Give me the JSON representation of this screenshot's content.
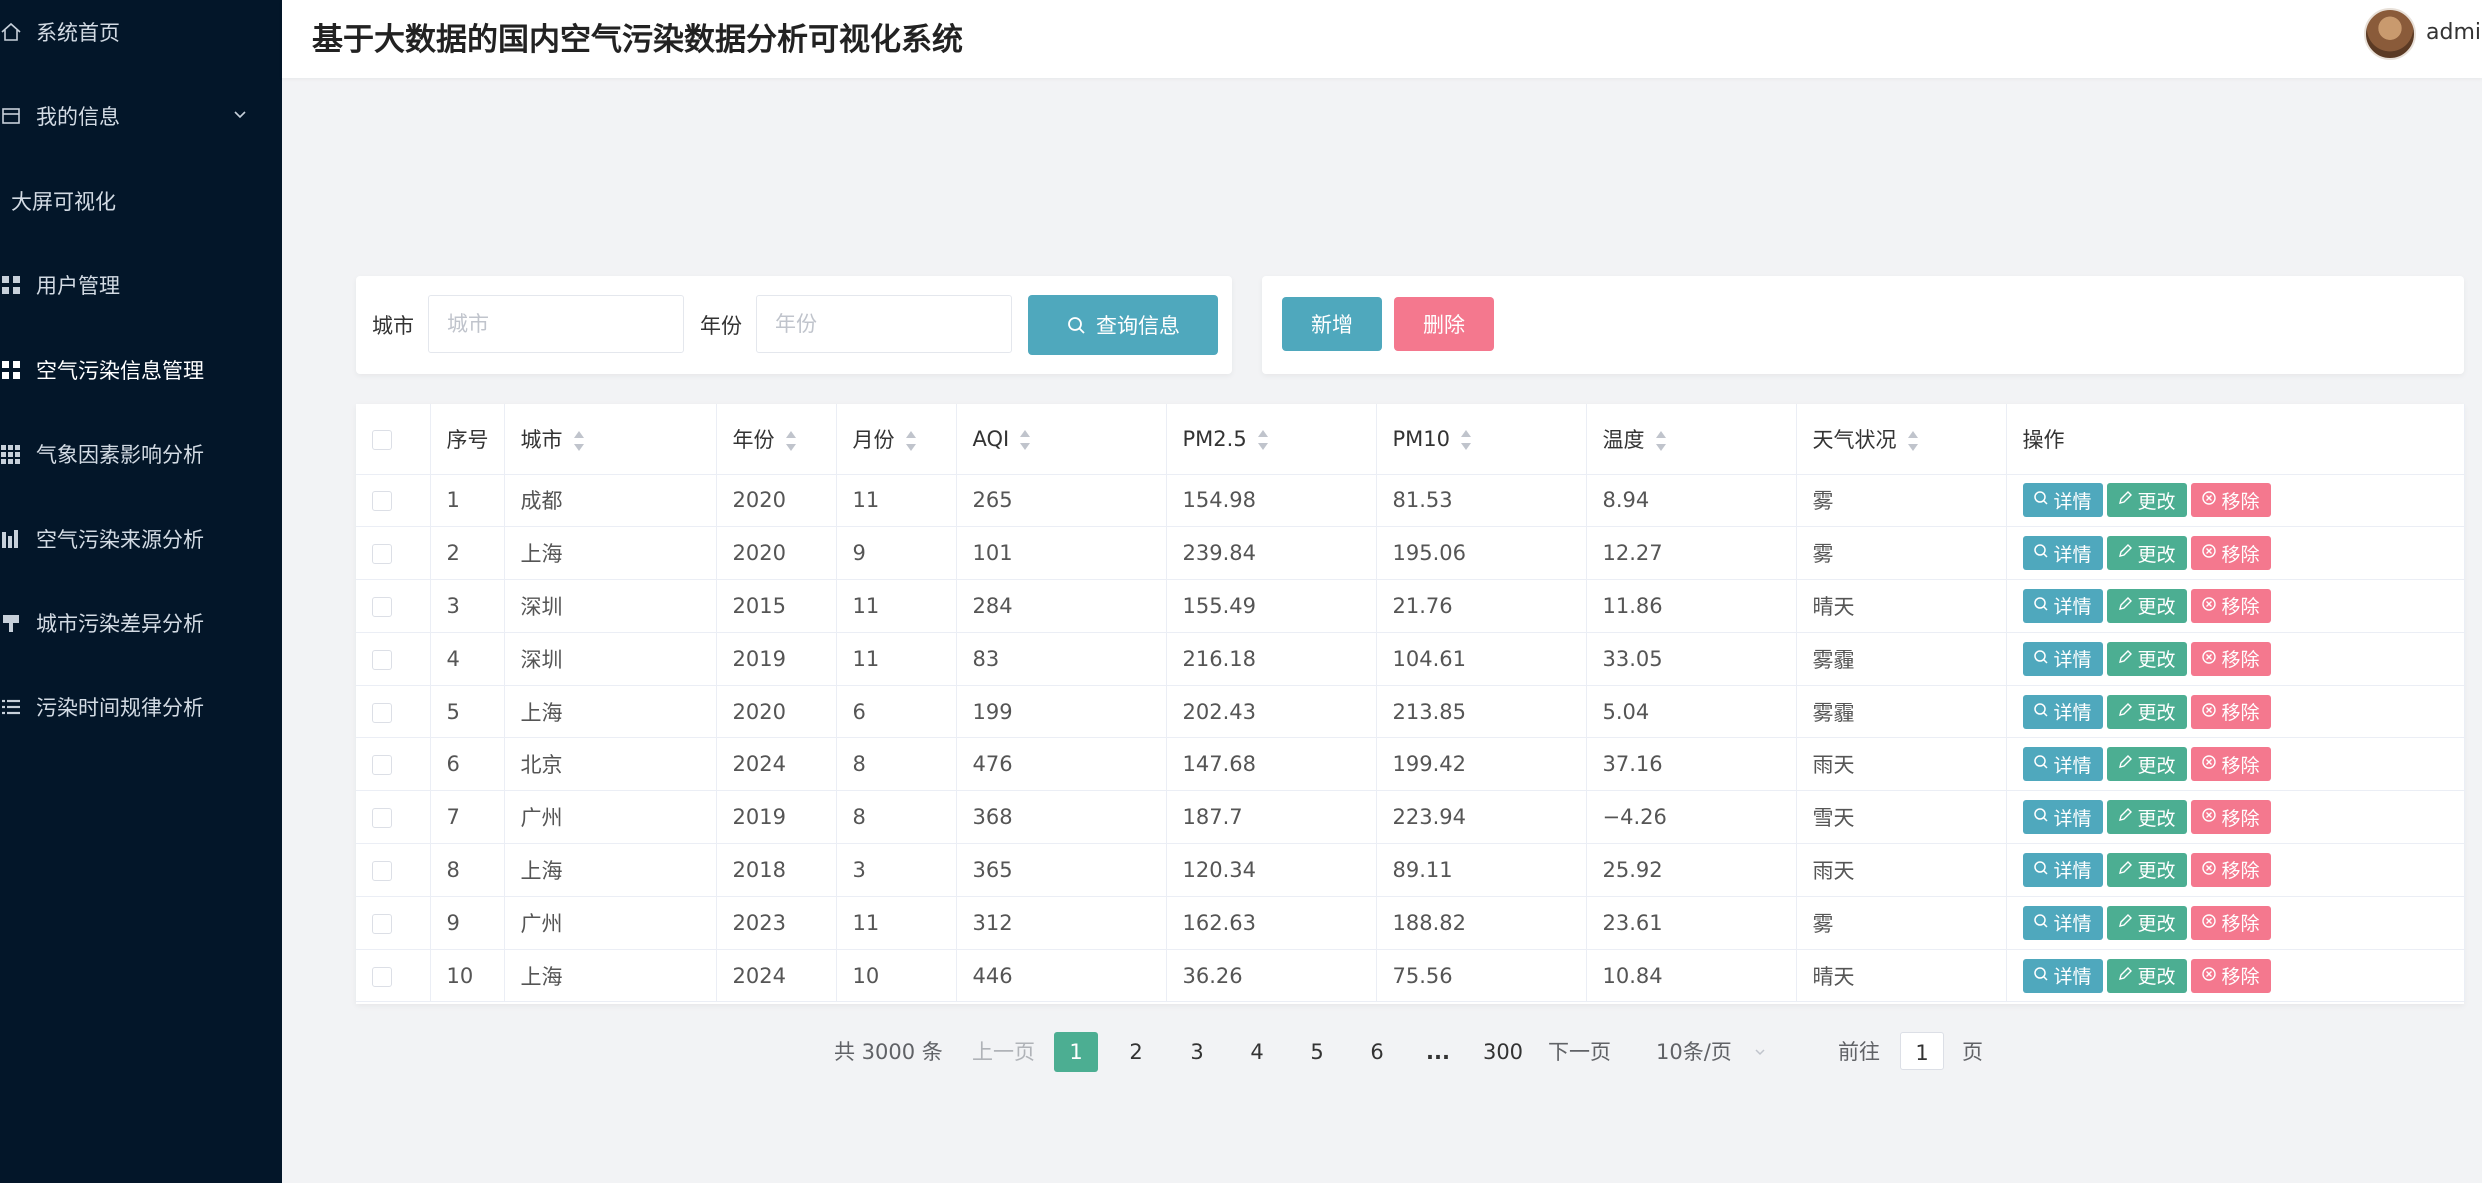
{
  "header": {
    "title": "基于大数据的国内空气污染数据分析可视化系统",
    "username": "admin"
  },
  "sidebar": {
    "items": [
      {
        "label": "系统首页",
        "icon": "home-icon"
      },
      {
        "label": "我的信息",
        "icon": "info-icon"
      },
      {
        "label": "大屏可视化",
        "icon": ""
      },
      {
        "label": "用户管理",
        "icon": "grid-icon"
      },
      {
        "label": "空气污染信息管理",
        "icon": "grid-icon",
        "active": true
      },
      {
        "label": "气象因素影响分析",
        "icon": "apps-icon"
      },
      {
        "label": "空气污染来源分析",
        "icon": "bar-icon"
      },
      {
        "label": "城市污染差异分析",
        "icon": "pin-icon"
      },
      {
        "label": "污染时间规律分析",
        "icon": "list-icon"
      }
    ]
  },
  "search": {
    "city_label": "城市",
    "city_placeholder": "城市",
    "year_label": "年份",
    "year_placeholder": "年份",
    "query_label": "查询信息"
  },
  "actions": {
    "add_label": "新增",
    "delete_label": "删除"
  },
  "table": {
    "headers": [
      "序号",
      "城市",
      "年份",
      "月份",
      "AQI",
      "PM2.5",
      "PM10",
      "温度",
      "天气状况",
      "操作"
    ],
    "rows": [
      [
        "1",
        "成都",
        "2020",
        "11",
        "265",
        "154.98",
        "81.53",
        "8.94",
        "雾"
      ],
      [
        "2",
        "上海",
        "2020",
        "9",
        "101",
        "239.84",
        "195.06",
        "12.27",
        "雾"
      ],
      [
        "3",
        "深圳",
        "2015",
        "11",
        "284",
        "155.49",
        "21.76",
        "11.86",
        "晴天"
      ],
      [
        "4",
        "深圳",
        "2019",
        "11",
        "83",
        "216.18",
        "104.61",
        "33.05",
        "雾霾"
      ],
      [
        "5",
        "上海",
        "2020",
        "6",
        "199",
        "202.43",
        "213.85",
        "5.04",
        "雾霾"
      ],
      [
        "6",
        "北京",
        "2024",
        "8",
        "476",
        "147.68",
        "199.42",
        "37.16",
        "雨天"
      ],
      [
        "7",
        "广州",
        "2019",
        "8",
        "368",
        "187.7",
        "223.94",
        "−4.26",
        "雪天"
      ],
      [
        "8",
        "上海",
        "2018",
        "3",
        "365",
        "120.34",
        "89.11",
        "25.92",
        "雨天"
      ],
      [
        "9",
        "广州",
        "2023",
        "11",
        "312",
        "162.63",
        "188.82",
        "23.61",
        "雾"
      ],
      [
        "10",
        "上海",
        "2024",
        "10",
        "446",
        "36.26",
        "75.56",
        "10.84",
        "晴天"
      ]
    ],
    "op_detail": "详情",
    "op_edit": "更改",
    "op_remove": "移除"
  },
  "pagination": {
    "total": "共 3000 条",
    "prev": "上一页",
    "pages": [
      "1",
      "2",
      "3",
      "4",
      "5",
      "6"
    ],
    "ellipsis": "...",
    "last": "300",
    "next": "下一页",
    "page_size": "10条/页",
    "goto_label": "前往",
    "goto_value": "1",
    "page_suffix": "页"
  },
  "colors": {
    "sidebar_bg": "#031629",
    "primary": "#4fa8bd",
    "success": "#4cae92",
    "danger": "#f4788e"
  }
}
